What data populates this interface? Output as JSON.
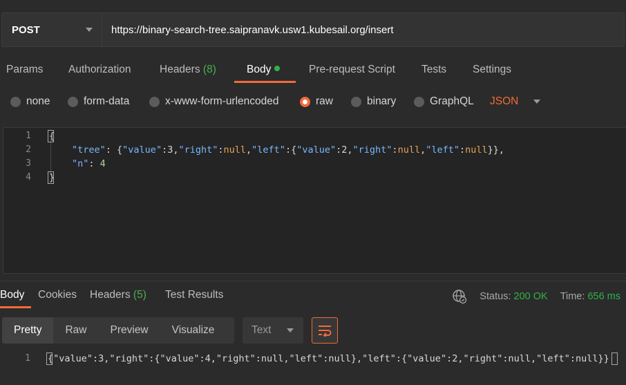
{
  "request": {
    "method": "POST",
    "url": "https://binary-search-tree.saipranavk.usw1.kubesail.org/insert"
  },
  "request_tabs": {
    "params": "Params",
    "authorization": "Authorization",
    "headers": "Headers",
    "headers_count": "(8)",
    "body": "Body",
    "prerequest": "Pre-request Script",
    "tests": "Tests",
    "settings": "Settings"
  },
  "body_types": {
    "none": "none",
    "form_data": "form-data",
    "urlencoded": "x-www-form-urlencoded",
    "raw": "raw",
    "binary": "binary",
    "graphql": "GraphQL",
    "format": "JSON",
    "selected": "raw"
  },
  "editor": {
    "line_numbers": [
      "1",
      "2",
      "3",
      "4"
    ],
    "line1": "{",
    "l2_key_tree": "\"tree\"",
    "l2_colon": ": {",
    "l2_k_value": "\"value\"",
    "l2_v_value": ":3,",
    "l2_k_right": "\"right\"",
    "l2_colon_right": ":",
    "l2_null1": "null",
    "l2_comma1": ",",
    "l2_k_left": "\"left\"",
    "l2_colon_left": ":{",
    "l2_k_value2": "\"value\"",
    "l2_v_value2": ":2,",
    "l2_k_right2": "\"right\"",
    "l2_colon_right2": ":",
    "l2_null2": "null",
    "l2_comma2": ",",
    "l2_k_left2": "\"left\"",
    "l2_colon_left2": ":",
    "l2_null3": "null",
    "l2_end": "}},",
    "l3_key_n": "\"n\"",
    "l3_colon": ": ",
    "l3_val": "4",
    "line4": "}"
  },
  "response_tabs": {
    "body": "Body",
    "cookies": "Cookies",
    "headers": "Headers",
    "headers_count": "(5)",
    "test_results": "Test Results"
  },
  "status": {
    "status_label": "Status:",
    "status_value": "200 OK",
    "time_label": "Time:",
    "time_value": "656 ms"
  },
  "response_view": {
    "pretty": "Pretty",
    "raw": "Raw",
    "preview": "Preview",
    "visualize": "Visualize",
    "format": "Text"
  },
  "response_code": {
    "line_number": "1",
    "text": "{\"value\":3,\"right\":{\"value\":4,\"right\":null,\"left\":null},\"left\":{\"value\":2,\"right\":null,\"left\":null}}"
  },
  "colors": {
    "accent": "#f26b3a",
    "success": "#30b24a",
    "background": "#2b2b2b"
  },
  "icons": [
    "chevron-down-icon",
    "globe-icon",
    "wrap-lines-icon"
  ]
}
